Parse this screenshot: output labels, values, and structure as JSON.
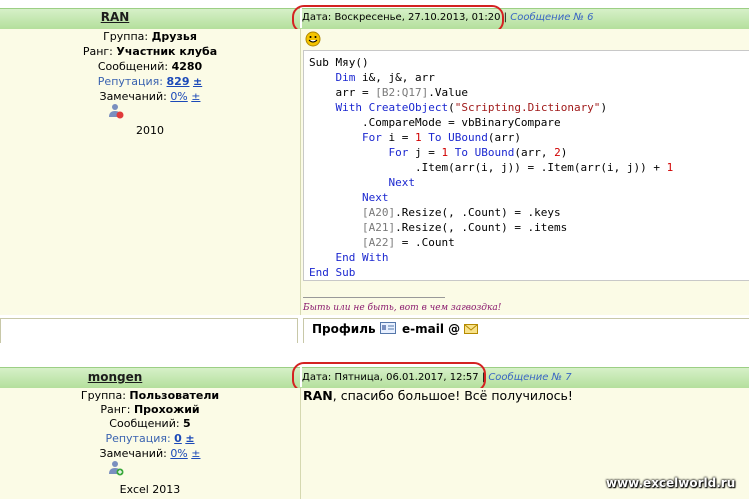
{
  "posts": [
    {
      "username": "RAN",
      "group_label": "Группа:",
      "group_value": "Друзья",
      "rank_label": "Ранг:",
      "rank_value": "Участник клуба",
      "messages_label": "Сообщений:",
      "messages_value": "4280",
      "reputation_label": "Репутация:",
      "reputation_value": "829",
      "reputation_pm": "±",
      "remarks_label": "Замечаний:",
      "remarks_value": "0%",
      "remarks_pm": "±",
      "extra": "2010",
      "date_text": "Дата: Воскресенье, 27.10.2013, 01:20 |",
      "msg_link": "Сообщение № 6",
      "code": [
        [
          [
            "plain",
            "Sub Мяу()"
          ]
        ],
        [
          [
            "plain",
            "    "
          ],
          [
            "kw",
            "Dim"
          ],
          [
            "plain",
            " i&, j&, arr"
          ]
        ],
        [
          [
            "plain",
            "    arr = "
          ],
          [
            "rng",
            "[B2:Q17]"
          ],
          [
            "plain",
            ".Value"
          ]
        ],
        [
          [
            "plain",
            "    "
          ],
          [
            "kw",
            "With"
          ],
          [
            "plain",
            " "
          ],
          [
            "kw",
            "CreateObject"
          ],
          [
            "plain",
            "("
          ],
          [
            "str",
            "\"Scripting.Dictionary\""
          ],
          [
            "plain",
            ")"
          ]
        ],
        [
          [
            "plain",
            "        .CompareMode = vbBinaryCompare"
          ]
        ],
        [
          [
            "plain",
            "        "
          ],
          [
            "kw",
            "For"
          ],
          [
            "plain",
            " i = "
          ],
          [
            "num",
            "1"
          ],
          [
            "plain",
            " "
          ],
          [
            "kw",
            "To"
          ],
          [
            "plain",
            " "
          ],
          [
            "kw",
            "UBound"
          ],
          [
            "plain",
            "(arr)"
          ]
        ],
        [
          [
            "plain",
            "            "
          ],
          [
            "kw",
            "For"
          ],
          [
            "plain",
            " j = "
          ],
          [
            "num",
            "1"
          ],
          [
            "plain",
            " "
          ],
          [
            "kw",
            "To"
          ],
          [
            "plain",
            " "
          ],
          [
            "kw",
            "UBound"
          ],
          [
            "plain",
            "(arr, "
          ],
          [
            "num",
            "2"
          ],
          [
            "plain",
            ")"
          ]
        ],
        [
          [
            "plain",
            "                .Item(arr(i, j)) = .Item(arr(i, j)) + "
          ],
          [
            "num",
            "1"
          ]
        ],
        [
          [
            "plain",
            "            "
          ],
          [
            "kw",
            "Next"
          ]
        ],
        [
          [
            "plain",
            "        "
          ],
          [
            "kw",
            "Next"
          ]
        ],
        [
          [
            "plain",
            "        "
          ],
          [
            "rng",
            "[A20]"
          ],
          [
            "plain",
            ".Resize(, .Count) = .keys"
          ]
        ],
        [
          [
            "plain",
            "        "
          ],
          [
            "rng",
            "[A21]"
          ],
          [
            "plain",
            ".Resize(, .Count) = .items"
          ]
        ],
        [
          [
            "plain",
            "        "
          ],
          [
            "rng",
            "[A22]"
          ],
          [
            "plain",
            " = .Count"
          ]
        ],
        [
          [
            "plain",
            "    "
          ],
          [
            "kw",
            "End With"
          ]
        ],
        [
          [
            "kw",
            "End Sub"
          ]
        ]
      ],
      "signature": "Быть или не быть, вот в чем загвоздка!",
      "profile_label": "Профиль",
      "email_label": "e-mail"
    },
    {
      "username": "mongen",
      "group_label": "Группа:",
      "group_value": "Пользователи",
      "rank_label": "Ранг:",
      "rank_value": "Прохожий",
      "messages_label": "Сообщений:",
      "messages_value": "5",
      "reputation_label": "Репутация:",
      "reputation_value": "0",
      "reputation_pm": "±",
      "remarks_label": "Замечаний:",
      "remarks_value": "0%",
      "remarks_pm": "±",
      "extra": "Excel 2013",
      "date_text": "Дата: Пятница, 06.01.2017, 12:57 |",
      "msg_link": "Сообщение № 7",
      "body_bold": "RAN",
      "body_rest": ", спасибо большое! Всё получилось!"
    }
  ],
  "watermark": "www.excelworld.ru",
  "colors": {
    "highlight_oval": "#d42222",
    "header_green": "#c4e6b0"
  },
  "icons": [
    "smiley-icon",
    "user-status-icon",
    "profile-card-icon",
    "email-envelope-icon",
    "add-user-icon"
  ]
}
